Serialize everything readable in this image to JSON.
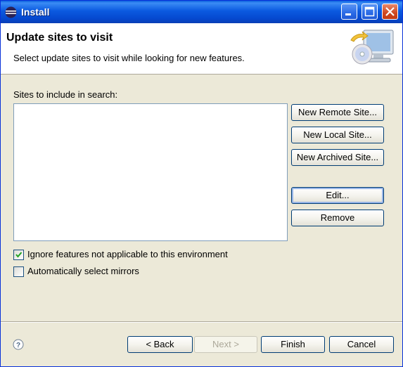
{
  "window": {
    "title": "Install",
    "controls": [
      "minimize-icon",
      "maximize-icon",
      "close-icon"
    ]
  },
  "header": {
    "title": "Update sites to visit",
    "description": "Select update sites to visit while looking for new features.",
    "image": "computer-with-cd-update-icon"
  },
  "sites": {
    "label": "Sites to include in search:",
    "items": []
  },
  "side_buttons": {
    "new_remote": "New Remote Site...",
    "new_local": "New Local Site...",
    "new_archived": "New Archived Site...",
    "edit": "Edit...",
    "remove": "Remove"
  },
  "options": {
    "ignore_features": {
      "label": "Ignore features not applicable to this environment",
      "checked": true
    },
    "auto_mirrors": {
      "label": "Automatically select mirrors",
      "checked": false
    }
  },
  "footer": {
    "help_icon": "help-icon",
    "back": "< Back",
    "next": "Next >",
    "finish": "Finish",
    "cancel": "Cancel"
  },
  "colors": {
    "title_bar": "#0548cf",
    "dialog_bg": "#ece9d8",
    "check_mark": "#21a121"
  }
}
